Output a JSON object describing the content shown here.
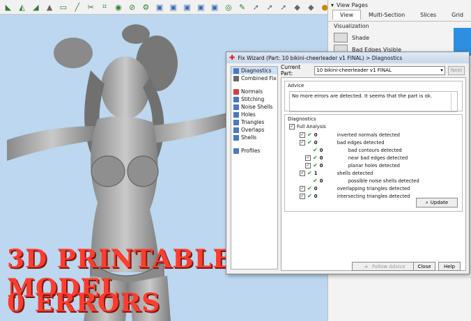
{
  "toolbar": {
    "icons": [
      "select-icon",
      "zone-icon",
      "plane-icon",
      "triangle-icon",
      "rect-icon",
      "line-icon",
      "cut-icon",
      "view-icon",
      "circle-icon",
      "measure-icon",
      "fix-icon",
      "box-icon",
      "box-icon",
      "box-icon",
      "box-icon",
      "box-icon",
      "globe-icon",
      "pen-icon",
      "arrow-icon",
      "arrow-icon",
      "arrow-icon",
      "tri-icon",
      "tri-icon",
      "dot-icon"
    ]
  },
  "overlay": {
    "line1": "3D PRINTABLE MODEL",
    "line2": "0 ERRORS"
  },
  "view_pages": {
    "header": "View Pages",
    "tabs": [
      "View",
      "Multi-Section",
      "Slices",
      "Grid"
    ],
    "section": "Visualization",
    "rows": [
      "Shade",
      "Bad Edges Visible"
    ]
  },
  "dialog": {
    "title": "Fix Wizard (Part: 10 bikini-cheerleader v1 FINAL) > Diagnostics",
    "nav": [
      {
        "label": "Diagnostics",
        "color": "#4a78c2",
        "active": true
      },
      {
        "label": "Combined Fix",
        "color": "#6a6a6a",
        "active": false
      },
      {
        "label": "Normals",
        "color": "#d04040",
        "active": false
      },
      {
        "label": "Stitching",
        "color": "#4a78c2",
        "active": false
      },
      {
        "label": "Noise Shells",
        "color": "#4a78c2",
        "active": false
      },
      {
        "label": "Holes",
        "color": "#4a78c2",
        "active": false
      },
      {
        "label": "Triangles",
        "color": "#4a78c2",
        "active": false
      },
      {
        "label": "Overlaps",
        "color": "#4a78c2",
        "active": false
      },
      {
        "label": "Shells",
        "color": "#4a78c2",
        "active": false
      },
      {
        "label": "Profiles",
        "color": "#4a78c2",
        "active": false
      }
    ],
    "current_part_label": "Current Part:",
    "current_part_value": "10 bikini-cheerleader v1 FINAL",
    "next_label": "Next",
    "advice_title": "Advice",
    "advice_text": "No more errors are detected. It seems that the part is ok.",
    "diagnostics_title": "Diagnostics",
    "full_analysis_label": "Full Analysis",
    "diag_rows": [
      {
        "count": "0",
        "label": "inverted normals detected",
        "indent": 0,
        "checkbox": true
      },
      {
        "count": "0",
        "label": "bad edges detected",
        "indent": 0,
        "checkbox": true
      },
      {
        "count": "0",
        "label": "bad contours detected",
        "indent": 1,
        "checkbox": false
      },
      {
        "count": "0",
        "label": "near bad edges detected",
        "indent": 1,
        "checkbox": true
      },
      {
        "count": "0",
        "label": "planar holes detected",
        "indent": 1,
        "checkbox": true
      },
      {
        "count": "1",
        "label": "shells detected",
        "indent": 0,
        "checkbox": true
      },
      {
        "count": "0",
        "label": "possible noise shells detected",
        "indent": 1,
        "checkbox": false
      },
      {
        "count": "0",
        "label": "overlapping triangles detected",
        "indent": 0,
        "checkbox": true
      },
      {
        "count": "0",
        "label": "intersecting triangles detected",
        "indent": 0,
        "checkbox": true
      }
    ],
    "update_label": "Update",
    "follow_advice_label": "Follow Advice",
    "close_label": "Close",
    "help_label": "Help"
  }
}
